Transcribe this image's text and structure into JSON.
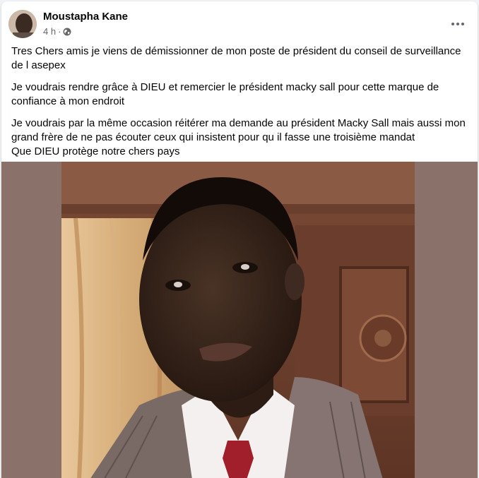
{
  "post": {
    "author": "Moustapha Kane",
    "time": "4 h",
    "separator": "·",
    "privacy_icon": "globe-icon",
    "more_icon": "more-horizontal-icon",
    "paragraphs": [
      "Tres Chers amis je viens de démissionner de mon poste de président du conseil de surveillance de l asepex",
      "Je voudrais rendre grâce à DIEU et remercier le président macky sall pour cette marque de confiance à mon endroit",
      "Je voudrais par la même occasion réitérer ma demande au président Macky Sall mais aussi mon grand frère de ne pas écouter ceux qui insistent pour qu il fasse une troisième mandat",
      "Que DIEU protège notre chers pays"
    ]
  },
  "colors": {
    "text_primary": "#050505",
    "text_secondary": "#65676b",
    "photo_backdrop": "#8a716a"
  }
}
